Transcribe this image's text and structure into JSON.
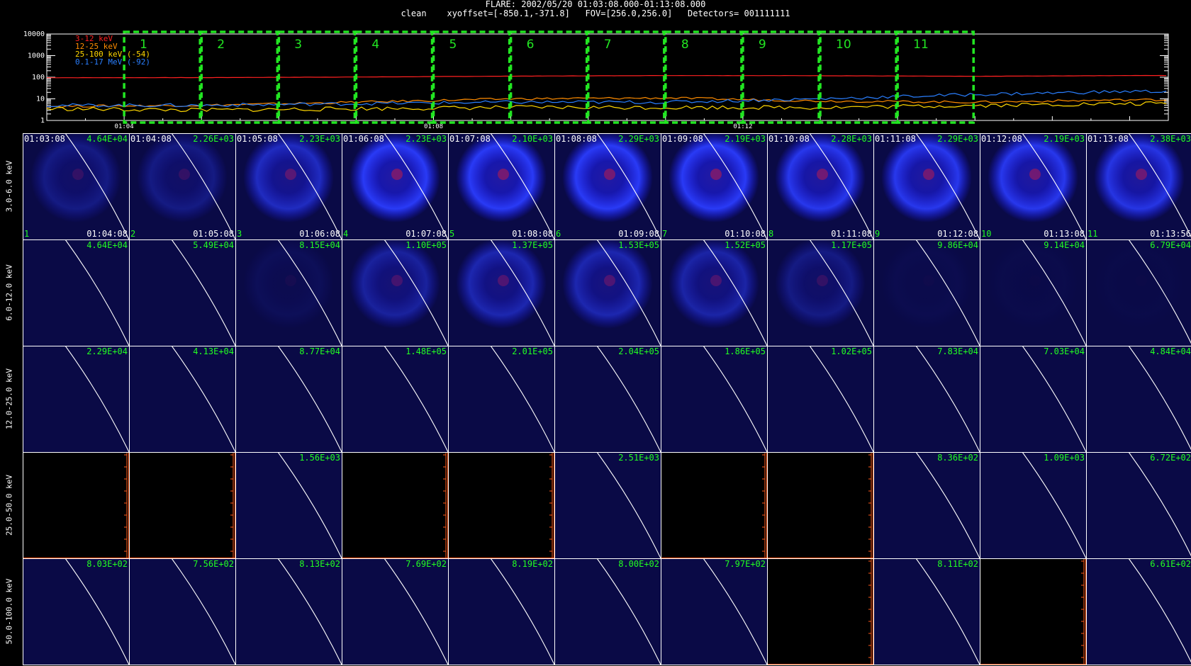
{
  "header": {
    "title": "FLARE: 2002/05/20 01:03:08.000-01:13:08.000",
    "line2": "clean    xyoffset=[-850.1,-371.8]   FOV=[256.0,256.0]   Detectors= 001111111"
  },
  "chart_data": [
    {
      "type": "line",
      "title": "",
      "yscale": "log",
      "ylim": [
        1,
        10000
      ],
      "y_tick_labels": [
        "1",
        "10",
        "100",
        "1000",
        "10000"
      ],
      "x_tick_labels": [
        "01:04",
        "01:08",
        "01:12"
      ],
      "legend": [
        {
          "label": "3-12 keV",
          "color": "#ff2020"
        },
        {
          "label": "12-25 keV",
          "color": "#ff8c00"
        },
        {
          "label": "25-100 keV (-54)",
          "color": "#ffd700"
        },
        {
          "label": "0.1-17 MeV (-92)",
          "color": "#2a7fff"
        }
      ],
      "series": [
        {
          "name": "3-12 keV",
          "color": "#ff2020",
          "x_minutes": [
            0,
            2,
            4,
            6,
            8,
            10,
            12,
            14
          ],
          "values": [
            95,
            96,
            102,
            112,
            120,
            118,
            110,
            120
          ]
        },
        {
          "name": "12-25 keV",
          "color": "#ff8c00",
          "x_minutes": [
            0,
            2,
            4,
            6,
            8,
            10,
            12,
            14
          ],
          "values": [
            4.5,
            5,
            7,
            10,
            11,
            8,
            7,
            9
          ]
        },
        {
          "name": "25-100 keV (-54)",
          "color": "#ffd700",
          "x_minutes": [
            0,
            2,
            4,
            6,
            8,
            10,
            12,
            14
          ],
          "values": [
            3.5,
            3,
            3.5,
            4,
            4,
            4,
            5,
            6
          ]
        },
        {
          "name": "0.1-17 MeV (-92)",
          "color": "#2a7fff",
          "x_minutes": [
            0,
            2,
            4,
            6,
            8,
            10,
            12,
            14
          ],
          "values": [
            5,
            5,
            6,
            7,
            7,
            10,
            16,
            22
          ]
        }
      ],
      "intervals": [
        "1",
        "2",
        "3",
        "4",
        "5",
        "6",
        "7",
        "8",
        "9",
        "10",
        "11"
      ]
    },
    {
      "type": "image-grid",
      "row_labels": [
        "3.0-6.0 keV",
        "6.0-12.0 keV",
        "12.0-25.0 keV",
        "25.0-50.0 keV",
        "50.0-100.0 keV"
      ],
      "start_times": [
        "01:03:08",
        "01:04:08",
        "01:05:08",
        "01:06:08",
        "01:07:08",
        "01:08:08",
        "01:09:08",
        "01:10:08",
        "01:11:08",
        "01:12:08",
        "01:13:08"
      ],
      "end_times": [
        "01:04:08",
        "01:05:08",
        "01:06:08",
        "01:07:08",
        "01:08:08",
        "01:09:08",
        "01:10:08",
        "01:11:08",
        "01:12:08",
        "01:13:08",
        "01:13:56"
      ],
      "interval_numbers": [
        "1",
        "2",
        "3",
        "4",
        "5",
        "6",
        "7",
        "8",
        "9",
        "10",
        "11"
      ],
      "peaks": [
        [
          "4.64E+04",
          "2.26E+03",
          "2.23E+03",
          "2.23E+03",
          "2.10E+03",
          "2.29E+03",
          "2.19E+03",
          "2.28E+03",
          "2.29E+03",
          "2.19E+03",
          "2.38E+03"
        ],
        [
          "4.64E+04",
          "5.49E+04",
          "8.15E+04",
          "1.10E+05",
          "1.37E+05",
          "1.53E+05",
          "1.52E+05",
          "1.17E+05",
          "9.86E+04",
          "9.14E+04",
          "6.79E+04"
        ],
        [
          "2.29E+04",
          "4.13E+04",
          "8.77E+04",
          "1.48E+05",
          "2.01E+05",
          "2.04E+05",
          "1.86E+05",
          "1.02E+05",
          "7.83E+04",
          "7.03E+04",
          "4.84E+04"
        ],
        [
          "",
          "",
          "1.56E+03",
          "",
          "",
          "2.51E+03",
          "",
          "",
          "8.36E+02",
          "1.09E+03",
          "6.72E+02"
        ],
        [
          "8.03E+02",
          "7.56E+02",
          "8.13E+02",
          "7.69E+02",
          "8.19E+02",
          "8.00E+02",
          "7.97E+02",
          "",
          "8.11E+02",
          "",
          "6.61E+02"
        ]
      ],
      "ring_intensity": [
        [
          0.35,
          0.35,
          0.7,
          1,
          1,
          1,
          1,
          0.95,
          0.95,
          0.95,
          0.9
        ],
        [
          0,
          0,
          0.1,
          0.5,
          0.6,
          0.6,
          0.55,
          0.35,
          0.05,
          0.03,
          0.02
        ],
        [
          0,
          0,
          0,
          0,
          0,
          0,
          0,
          0,
          0,
          0,
          0
        ],
        [
          0,
          0,
          0,
          0,
          0,
          0,
          0,
          0,
          0,
          0,
          0
        ],
        [
          0,
          0,
          0,
          0,
          0,
          0,
          0,
          0,
          0,
          0,
          0
        ]
      ],
      "no_data": [
        [
          false,
          false,
          false,
          false,
          false,
          false,
          false,
          false,
          false,
          false,
          false
        ],
        [
          false,
          false,
          false,
          false,
          false,
          false,
          false,
          false,
          false,
          false,
          false
        ],
        [
          false,
          false,
          false,
          false,
          false,
          false,
          false,
          false,
          false,
          false,
          false
        ],
        [
          true,
          true,
          false,
          true,
          true,
          false,
          true,
          true,
          false,
          false,
          false
        ],
        [
          false,
          false,
          false,
          false,
          false,
          false,
          false,
          true,
          false,
          true,
          false
        ]
      ]
    }
  ]
}
